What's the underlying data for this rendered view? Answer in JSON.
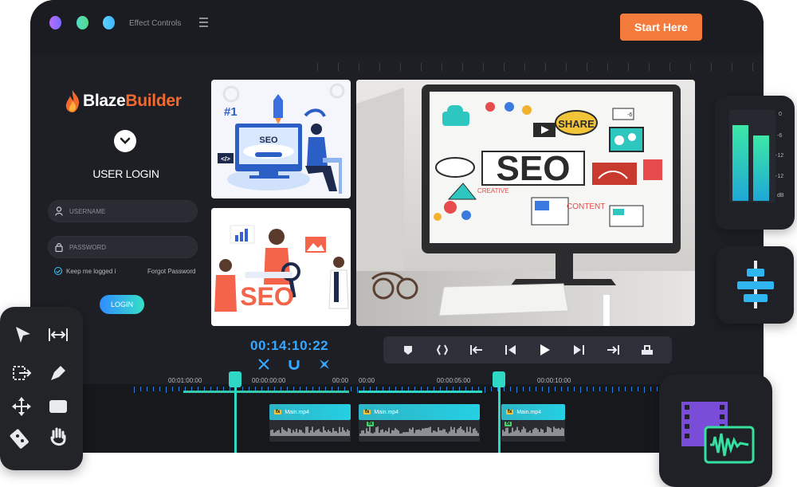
{
  "window": {
    "title": "Effect Controls",
    "cta_label": "Start Here"
  },
  "brand": {
    "name_part1": "Blaze",
    "name_part2": "Builder",
    "accent": "#f26a2e"
  },
  "login": {
    "title": "USER LOGIN",
    "username_placeholder": "USERNAME",
    "password_placeholder": "PASSWORD",
    "remember_label": "Keep me logged i",
    "forgot_label": "Forgot Password",
    "submit_label": "LOGIN"
  },
  "thumbnails": {
    "thumb1": {
      "rank": "#1",
      "text": "SEO",
      "code": "</>"
    },
    "thumb2": {
      "text": "SEO"
    },
    "main": {
      "text": "SEO",
      "share": "SHARE",
      "content": "CONTENT",
      "creative": "CREATIVE"
    }
  },
  "transport": {
    "timecode": "00:14:10:22"
  },
  "timeline": {
    "marks": [
      "00:01:00:00",
      "00:00:00:00",
      "00:00",
      "00:00",
      "00:00:05:00",
      "00:00:10:00"
    ],
    "clips": [
      {
        "fx": "fx",
        "name": "Main.mp4"
      },
      {
        "fx": "fx",
        "name": "Main.mp4"
      },
      {
        "fx": "fx",
        "name": "Main.mp4"
      }
    ],
    "audio_fx": [
      "fx",
      "fx"
    ]
  },
  "meter": {
    "labels": [
      "0",
      "-6",
      "-12",
      "-12",
      "dB"
    ],
    "levels": [
      0.88,
      0.76
    ]
  },
  "colors": {
    "accent_cta": "#f47b3c",
    "timecode": "#37a8ff",
    "playhead": "#2fd8c4"
  }
}
